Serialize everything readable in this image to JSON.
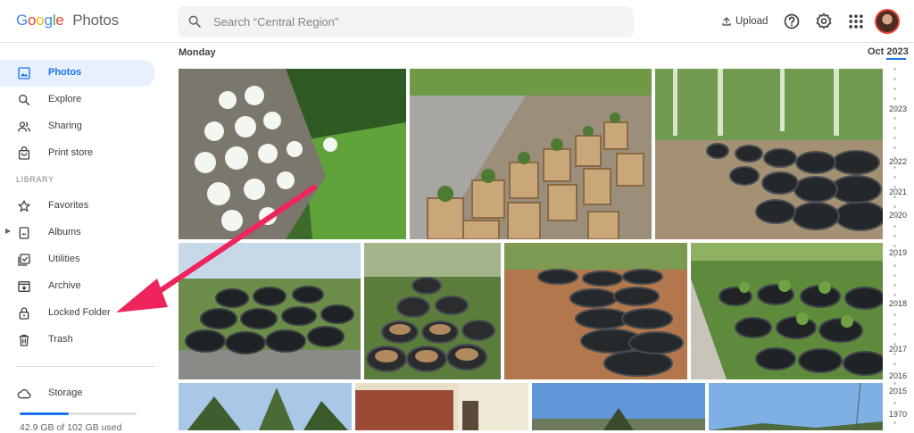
{
  "header": {
    "logo_google": "Google",
    "logo_photos": "Photos",
    "search_placeholder": "Search “Central Region”",
    "upload_label": "Upload"
  },
  "sidebar": {
    "items": [
      {
        "label": "Photos",
        "icon": "photo-icon",
        "active": true
      },
      {
        "label": "Explore",
        "icon": "search-icon"
      },
      {
        "label": "Sharing",
        "icon": "people-icon"
      },
      {
        "label": "Print store",
        "icon": "bag-icon"
      },
      {
        "label": "Favorites",
        "icon": "star-icon"
      },
      {
        "label": "Albums",
        "icon": "album-icon"
      },
      {
        "label": "Utilities",
        "icon": "checkbox-icon"
      },
      {
        "label": "Archive",
        "icon": "archive-icon"
      },
      {
        "label": "Locked Folder",
        "icon": "lock-icon"
      },
      {
        "label": "Trash",
        "icon": "trash-icon"
      }
    ],
    "library_label": "LIBRARY",
    "storage_label": "Storage",
    "storage_text": "42.9 GB of 102 GB used",
    "storage_fraction": 0.42
  },
  "main": {
    "day_label": "Monday",
    "month_label": "Oct 2023",
    "timeline_years": [
      "2023",
      "2022",
      "2021",
      "2020",
      "2019",
      "2018",
      "2017",
      "2016",
      "2015",
      "1970"
    ]
  },
  "colors": {
    "accent": "#1a73e8",
    "annotation_arrow": "#f0245c"
  }
}
